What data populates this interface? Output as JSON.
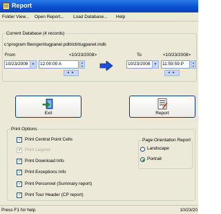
{
  "window": {
    "title": "Report"
  },
  "menu": [
    "Folder View...",
    "Open Report...",
    "Load Database...",
    "Help"
  ],
  "database": {
    "group_title": "Current Database (4 records)",
    "path": "c:\\program files\\gen\\tugpanel.pdb\\lcb\\tugpanel.mdb"
  },
  "from": {
    "label": "From",
    "range_hint": "<10/23/2008>",
    "date": "10/23/2008",
    "time": "12:00:00 A"
  },
  "to": {
    "label": "To",
    "range_hint": "<10/23/2008>",
    "date": "10/23/2008",
    "time": "11:59:59 P"
  },
  "buttons": {
    "exit": "Exit",
    "report": "Report"
  },
  "print_options": {
    "title": "Print Options",
    "items": [
      {
        "label": "Print Central Point Cells",
        "checked": true,
        "enabled": true
      },
      {
        "label": "Print Legend",
        "checked": true,
        "enabled": false
      },
      {
        "label": "Print Download Info",
        "checked": true,
        "enabled": true
      },
      {
        "label": "Print Exceptions Info",
        "checked": true,
        "enabled": true
      },
      {
        "label": "Print Personnel (Summary report)",
        "checked": true,
        "enabled": true
      },
      {
        "label": "Print Tour Header (CP report)",
        "checked": true,
        "enabled": true
      }
    ]
  },
  "orientation": {
    "title": "Page Orientation Report",
    "landscape": "Landscape",
    "portrait": "Portrait",
    "selected": "portrait"
  },
  "status": {
    "text": "Press F1 for help",
    "date": "10/23/20"
  },
  "colors": {
    "title_bar": "#0a4fd0",
    "face": "#ece9d8",
    "accent_arrow": "#1d4fd8"
  }
}
